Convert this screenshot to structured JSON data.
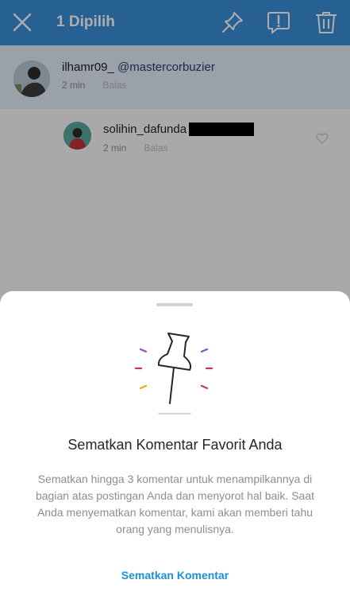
{
  "topbar": {
    "title": "1 Dipilih",
    "close_icon": "close-icon",
    "pin_icon": "pin-icon",
    "report_icon": "report-icon",
    "delete_icon": "trash-icon",
    "background": "#3a8ed8"
  },
  "comments": [
    {
      "username": "ilhamr09_",
      "mention": "@mastercorbuzier",
      "time": "2 min",
      "reply": "Balas",
      "selected": true
    },
    {
      "username": "solihin_dafunda",
      "time": "2 min",
      "reply": "Balas"
    }
  ],
  "sheet": {
    "title": "Sematkan Komentar Favorit Anda",
    "body": "Sematkan hingga 3 komentar untuk menampilkannya di bagian atas postingan Anda dan menyorot hal baik. Saat Anda menyematkan komentar, kami akan memberi tahu orang yang menulisnya.",
    "action": "Sematkan Komentar",
    "accent": "#1d8fd6"
  }
}
